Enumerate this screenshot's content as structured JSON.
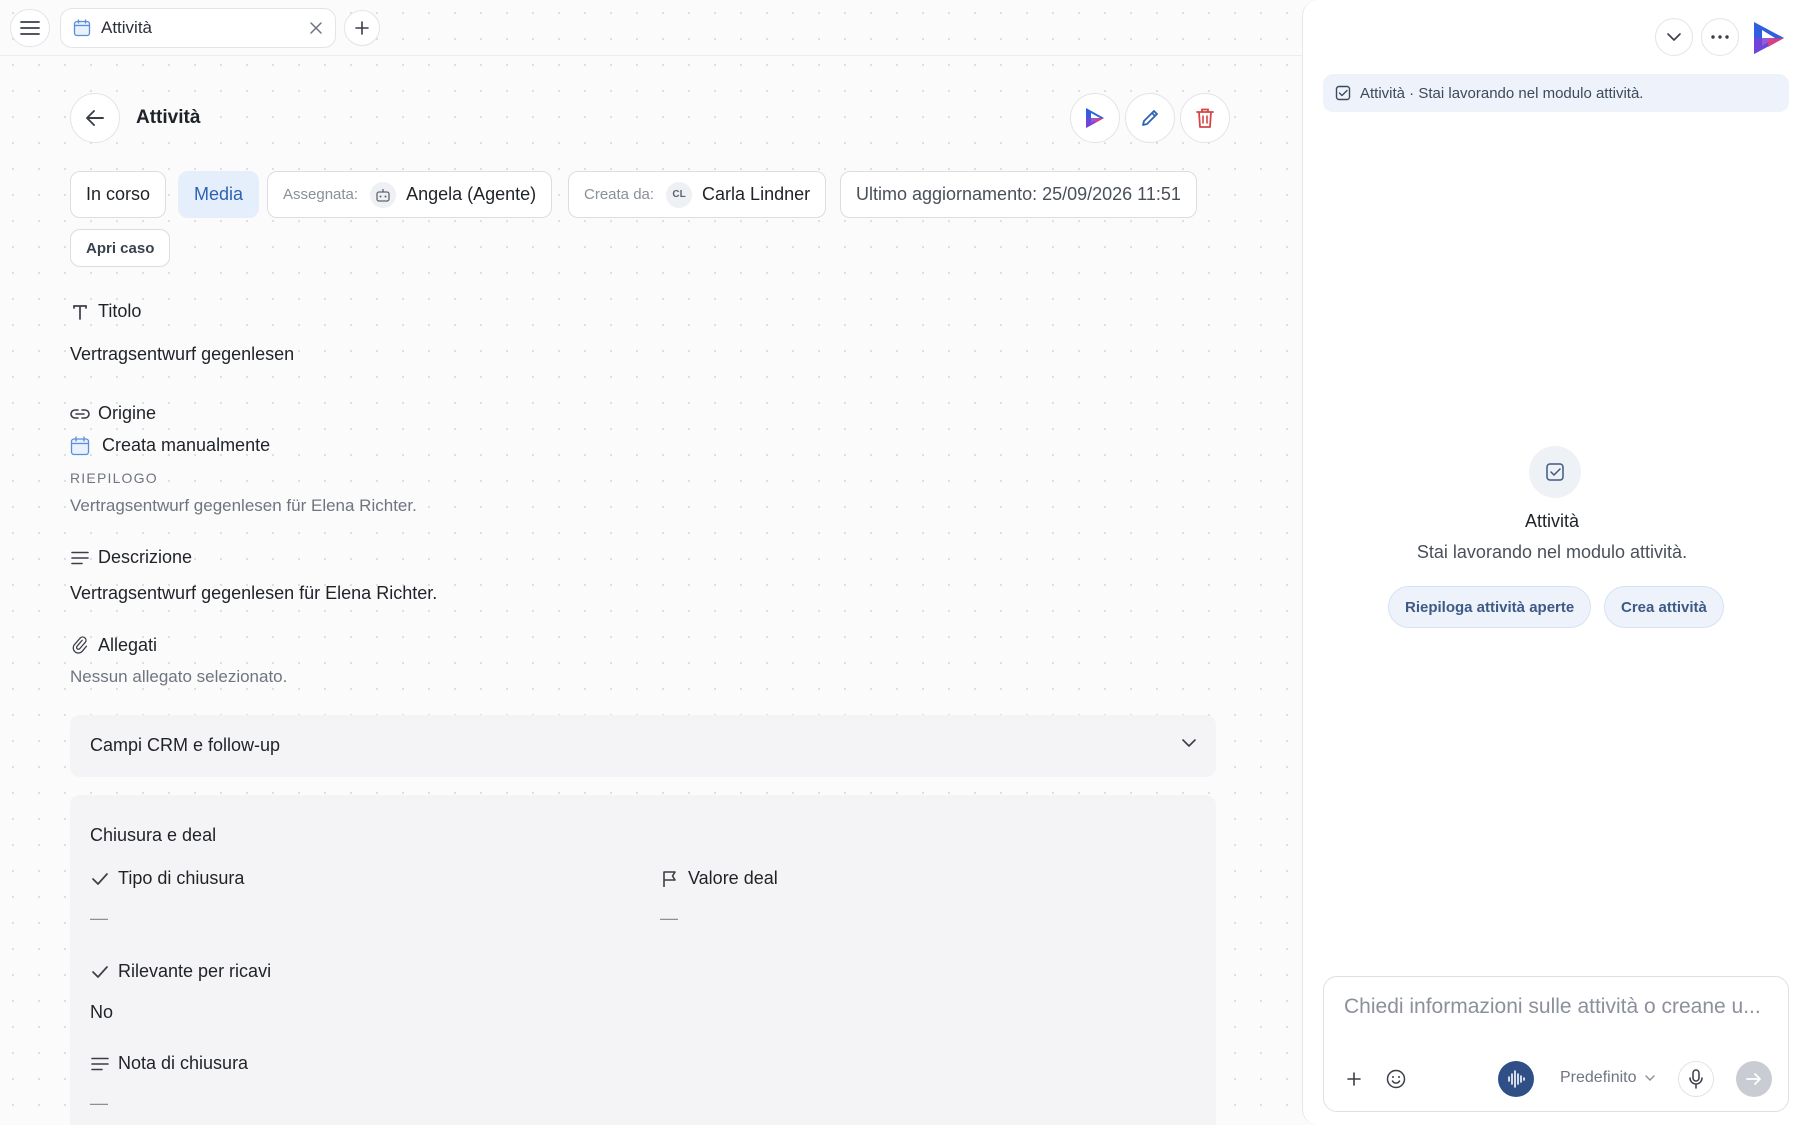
{
  "tabbar": {
    "tab_label": "Attività"
  },
  "header": {
    "title": "Attività"
  },
  "chips": {
    "status": "In corso",
    "priority": "Media",
    "assigned_key": "Assegnata:",
    "assigned_value": "Angela (Agente)",
    "created_key": "Creata da:",
    "creator_initials": "CL",
    "created_value": "Carla Lindner",
    "updated": "Ultimo aggiornamento: 25/09/2026 11:51"
  },
  "open_case_label": "Apri caso",
  "fields": {
    "title_label": "Titolo",
    "title_value": "Vertragsentwurf gegenlesen",
    "origin_label": "Origine",
    "origin_value": "Creata manualmente",
    "summary_label": "RIEPILOGO",
    "summary_value": "Vertragsentwurf gegenlesen für Elena Richter.",
    "description_label": "Descrizione",
    "description_value": "Vertragsentwurf gegenlesen für Elena Richter.",
    "attachments_label": "Allegati",
    "attachments_value": "Nessun allegato selezionato."
  },
  "crm": {
    "title": "Campi CRM e follow-up",
    "closing_title": "Chiusura e deal",
    "closing_type_label": "Tipo di chiusura",
    "closing_type_value": "—",
    "deal_value_label": "Valore deal",
    "deal_value_value": "—",
    "revenue_label": "Rilevante per ricavi",
    "revenue_value": "No",
    "closing_note_label": "Nota di chiusura",
    "closing_note_value": "—"
  },
  "panel": {
    "context_text": "Attività · Stai lavorando nel modulo attività.",
    "empty_title": "Attività",
    "empty_subtitle": "Stai lavorando nel modulo attività.",
    "suggestions": [
      "Riepiloga attività aperte",
      "Crea attività"
    ],
    "composer_placeholder": "Chiedi informazioni sulle attività o creane u...",
    "mode_label": "Predefinito"
  },
  "colors": {
    "accent_blue": "#2d62b4",
    "delete_red": "#d64545",
    "logo_blue": "#2f5fe0",
    "logo_purple": "#7b3fd6"
  }
}
